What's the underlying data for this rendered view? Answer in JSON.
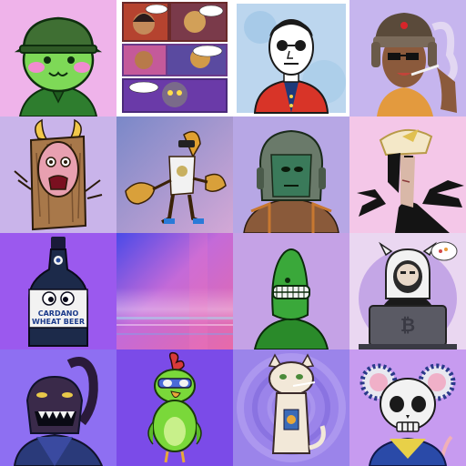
{
  "tiles": [
    {
      "name": "green-frog-soldier",
      "bg": "#f0b6ec"
    },
    {
      "name": "comic-page",
      "bg": "#ffffff"
    },
    {
      "name": "man-with-glasses-painting",
      "bg": "#bcd6ee"
    },
    {
      "name": "smoking-woman-ushanka",
      "bg": "#c6b5ee"
    },
    {
      "name": "wooden-block-demon",
      "bg": "#c9b4ea"
    },
    {
      "name": "crawfish-robot",
      "bg": "#b5a8d9"
    },
    {
      "name": "space-marine-helmet",
      "bg": "#b7a7e5"
    },
    {
      "name": "feathered-mask-figure",
      "bg": "#f4c7e8"
    },
    {
      "name": "cardano-wheat-beer-bottle",
      "bg": "#9b59ee"
    },
    {
      "name": "abstract-glitch-gradient",
      "bg": "#b56bd8"
    },
    {
      "name": "green-cucumber-man",
      "bg": "#c5a2e6"
    },
    {
      "name": "hooded-hacker-laptop",
      "bg": "#ead7f1"
    },
    {
      "name": "dark-dragon-robed",
      "bg": "#8e6ff2"
    },
    {
      "name": "green-parrot-bird",
      "bg": "#7b4be8"
    },
    {
      "name": "cat-with-cigarette",
      "bg": "#9b84ea"
    },
    {
      "name": "skull-mouse",
      "bg": "#c79bf0"
    }
  ],
  "beer_bottle": {
    "line1": "CARDANO",
    "line2": "WHEAT BEER"
  }
}
